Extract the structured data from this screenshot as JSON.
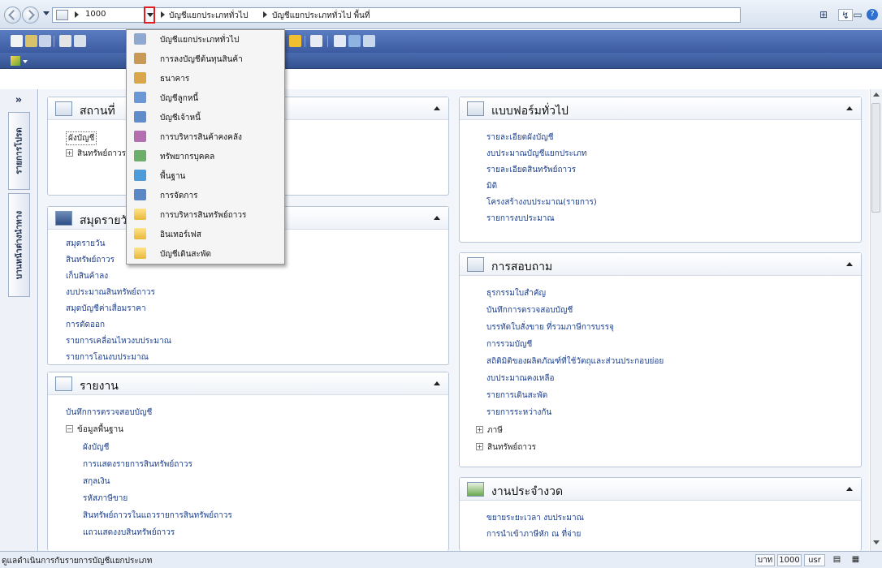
{
  "address_bar": {
    "company": "1000",
    "crumb1": "บัญชีแยกประเภททั่วไป",
    "crumb2": "บัญชีแยกประเภททั่วไป พื้นที่"
  },
  "sidebar": {
    "collapse": "»",
    "tab1": "รายการโปรด",
    "tab2": "บานหน้าต่างนำทาง"
  },
  "menu": {
    "items": [
      {
        "label": "บัญชีแยกประเภททั่วไป",
        "icon": "ledger-icon"
      },
      {
        "label": "การลงบัญชีต้นทุนสินค้า",
        "icon": "cost-accounting-icon"
      },
      {
        "label": "ธนาคาร",
        "icon": "bank-icon"
      },
      {
        "label": "บัญชีลูกหนี้",
        "icon": "receivable-icon"
      },
      {
        "label": "บัญชีเจ้าหนี้",
        "icon": "payable-icon"
      },
      {
        "label": "การบริหารสินค้าคงคลัง",
        "icon": "inventory-icon"
      },
      {
        "label": "ทรัพยากรบุคคล",
        "icon": "hr-icon"
      },
      {
        "label": "พื้นฐาน",
        "icon": "basic-icon"
      },
      {
        "label": "การจัดการ",
        "icon": "administration-icon"
      },
      {
        "label": "การบริหารสินทรัพย์ถาวร",
        "icon": "folder-icon"
      },
      {
        "label": "อินเทอร์เฟส",
        "icon": "folder-icon"
      },
      {
        "label": "บัญชีเดินสะพัด",
        "icon": "folder-icon"
      }
    ]
  },
  "panels": {
    "places": {
      "title": "สถานที่",
      "items": [
        "ผังบัญชี",
        "สินทรัพย์ถาวร"
      ]
    },
    "journals": {
      "title": "สมุดรายวัน",
      "items": [
        "สมุดรายวัน",
        "สินทรัพย์ถาวร",
        "เก็บสินค้าลง",
        "งบประมาณสินทรัพย์ถาวร",
        "สมุดบัญชีค่าเสื่อมราคา",
        "การตัดออก",
        "รายการเคลื่อนไหวงบประมาณ",
        "รายการโอนงบประมาณ"
      ]
    },
    "reports": {
      "title": "รายงาน",
      "item0": "บันทึกการตรวจสอบบัญชี",
      "group": "ข้อมูลพื้นฐาน",
      "subitems": [
        "ผังบัญชี",
        "การแสดงรายการสินทรัพย์ถาวร",
        "สกุลเงิน",
        "รหัสภาษีขาย",
        "สินทรัพย์ถาวรในแถวรายการสินทรัพย์ถาวร",
        "แถวแสดงงบสินทรัพย์ถาวร"
      ]
    },
    "forms": {
      "title": "แบบฟอร์มทั่วไป",
      "items": [
        "รายละเอียดผังบัญชี",
        "งบประมาณบัญชีแยกประเภท",
        "รายละเอียดสินทรัพย์ถาวร",
        "มิติ",
        "โครงสร้างงบประมาณ(รายการ)",
        "รายการงบประมาณ"
      ]
    },
    "inquiries": {
      "title": "การสอบถาม",
      "items": [
        "ธุรกรรมใบสำคัญ",
        "บันทึกการตรวจสอบบัญชี",
        "บรรทัดใบสั่งขาย ที่รวมภาษีการบรรจุ",
        "การรวมบัญชี",
        "สถิติมิติของผลิตภัณฑ์ที่ใช้วัตถุและส่วนประกอบย่อย",
        "งบประมาณคงเหลือ",
        "รายการเดินสะพัด",
        "รายการระหว่างกัน"
      ],
      "groups": [
        "ภาษี",
        "สินทรัพย์ถาวร"
      ]
    },
    "periodic": {
      "title": "งานประจำงวด",
      "items": [
        "ขยายระยะเวลา งบประมาณ",
        "การนำเข้าภาษีหัก ณ ที่จ่าย"
      ]
    }
  },
  "status_bar": {
    "text": "ดูแลดำเนินการกับรายการบัญชีแยกประเภท",
    "currency": "บาท",
    "company": "1000",
    "user": "usr"
  },
  "colors": {
    "toolbar": "#4565a8",
    "accent_red": "#e02020",
    "link": "#1b3f8f"
  }
}
